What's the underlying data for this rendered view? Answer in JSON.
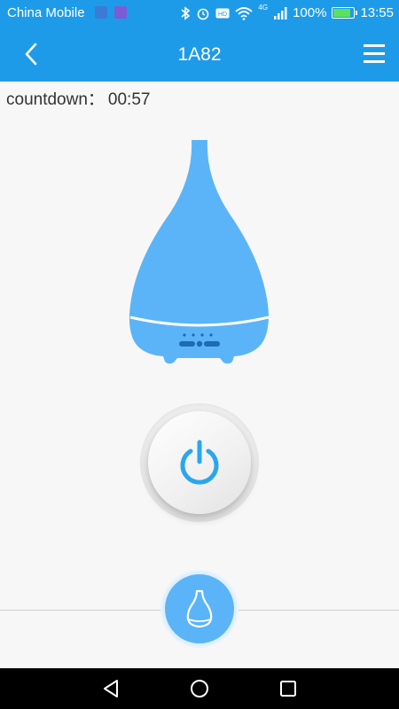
{
  "status_bar": {
    "carrier": "China Mobile",
    "battery_percent": "100%",
    "time": "13:55",
    "network": "4G",
    "icons": [
      "bluetooth-icon",
      "alarm-icon",
      "hd-icon",
      "wifi-icon",
      "signal-icon",
      "battery-icon"
    ]
  },
  "app_bar": {
    "title": "1A82",
    "back_icon": "chevron-left-icon",
    "menu_icon": "hamburger-menu-icon"
  },
  "countdown": {
    "label": "countdown：",
    "value": "00:57"
  },
  "device": {
    "image": "diffuser-illustration",
    "color": "#5bb4f7"
  },
  "controls": {
    "power_icon": "power-icon",
    "power_color": "#2aa6ee",
    "mist_icon": "droplet-icon",
    "mist_color": "#5bb4f7"
  },
  "nav_bar": {
    "icons": [
      "back-triangle-icon",
      "home-circle-icon",
      "recents-square-icon"
    ]
  },
  "colors": {
    "primary": "#1e9be8",
    "background": "#f7f7f7"
  }
}
